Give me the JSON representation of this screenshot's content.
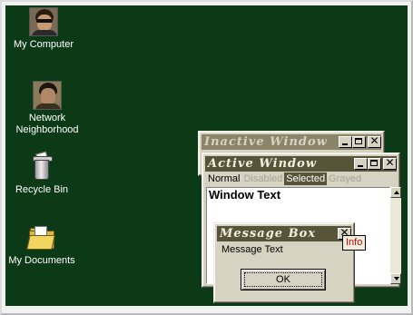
{
  "desktop": {
    "background": "#0d3a16",
    "icons": [
      {
        "label": "My Computer",
        "icon": "person-sunglasses-icon"
      },
      {
        "label_line1": "Network",
        "label_line2": "Neighborhood",
        "icon": "person-portrait-icon"
      },
      {
        "label": "Recycle Bin",
        "icon": "recycle-bin-icon"
      },
      {
        "label": "My Documents",
        "icon": "folder-documents-icon"
      }
    ]
  },
  "inactive_window": {
    "title": "Inactive Window",
    "title_color": "#8a8468"
  },
  "active_window": {
    "title": "Active Window",
    "title_color": "#58543a",
    "menu": {
      "normal": "Normal",
      "disabled": "Disabled",
      "selected": "Selected",
      "grayed": "Grayed"
    },
    "window_text": "Window Text"
  },
  "message_box": {
    "title": "Message Box",
    "message": "Message Text",
    "ok_label": "OK"
  },
  "tooltip": {
    "text": "Info",
    "text_color": "#b01010"
  }
}
